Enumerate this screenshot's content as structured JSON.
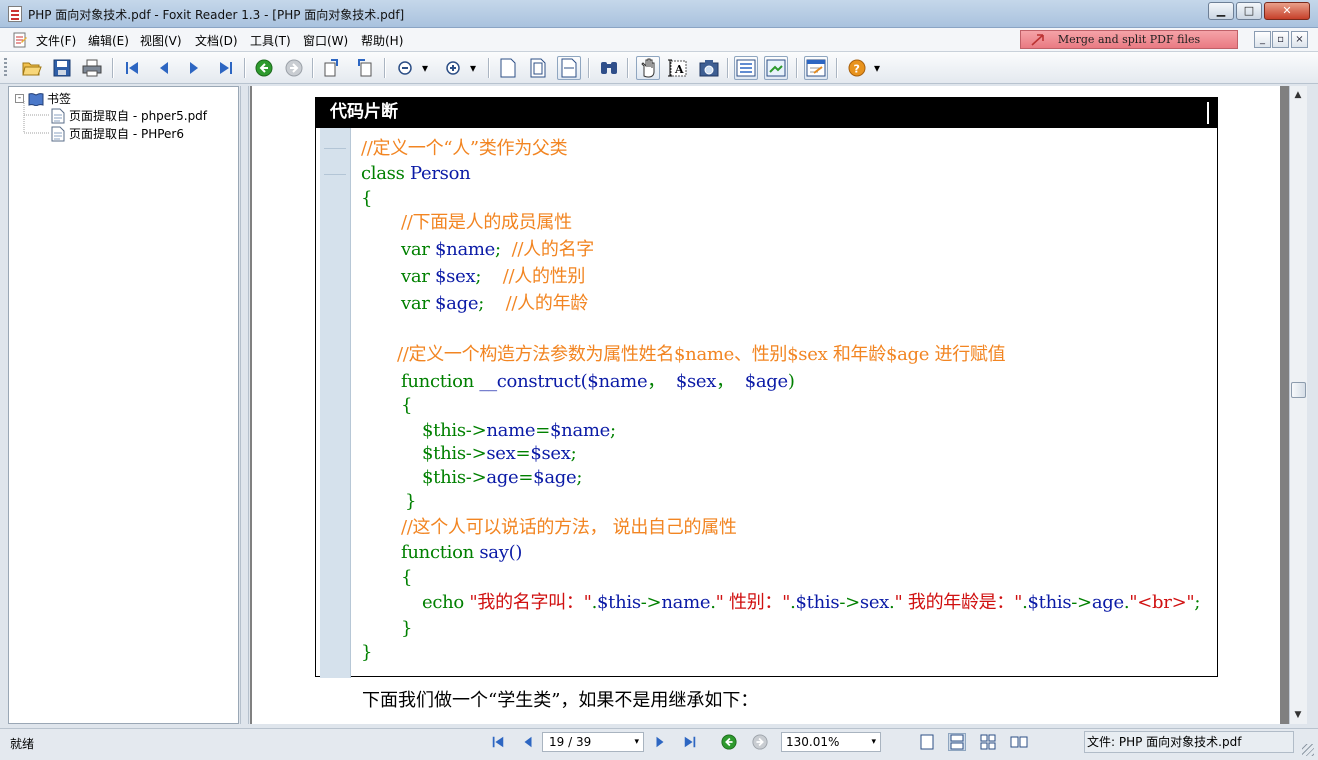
{
  "window": {
    "title": "PHP 面向对象技术.pdf - Foxit Reader 1.3 - [PHP 面向对象技术.pdf]",
    "minimize_glyph": "▁",
    "maximize_glyph": "□",
    "close_glyph": "✕"
  },
  "menu": {
    "items": [
      {
        "label": "文件(F)"
      },
      {
        "label": "编辑(E)"
      },
      {
        "label": "视图(V)"
      },
      {
        "label": "文档(D)"
      },
      {
        "label": "工具(T)"
      },
      {
        "label": "窗口(W)"
      },
      {
        "label": "帮助(H)"
      }
    ],
    "promo_label": "Merge and split PDF files",
    "mdi_minimize_glyph": "_",
    "mdi_restore_glyph": "▫",
    "mdi_close_glyph": "×"
  },
  "toolbar": {
    "icons": [
      "open-icon",
      "save-icon",
      "print-icon",
      "first-page-icon",
      "prev-page-icon",
      "next-page-icon",
      "last-page-icon",
      "back-icon",
      "forward-icon",
      "rotate-left-icon",
      "rotate-right-icon",
      "zoom-out-icon",
      "zoom-in-icon",
      "actual-size-icon",
      "fit-page-icon",
      "fit-width-icon",
      "find-icon",
      "hand-tool-icon",
      "text-select-icon",
      "snapshot-icon",
      "bookmarks-panel-icon",
      "thumbnails-panel-icon",
      "annotation-icon",
      "help-icon"
    ],
    "dropdown_glyph": "▾"
  },
  "bookmarks": {
    "root_label": "书签",
    "toggle_glyph": "-",
    "items": [
      {
        "label": "页面提取自 - phper5.pdf"
      },
      {
        "label": "页面提取自 - PHPer6"
      }
    ]
  },
  "document": {
    "box_title": "代码片断",
    "lines": [
      [
        {
          "t": "//定义一个“人”类作为父类",
          "c": "comment"
        }
      ],
      [
        {
          "t": "class ",
          "c": "kw"
        },
        {
          "t": "Person",
          "c": "id"
        }
      ],
      [
        {
          "t": "{",
          "c": "kw"
        }
      ],
      [
        {
          "t": "//下面是人的成员属性",
          "c": "comment"
        }
      ],
      [
        {
          "t": "var ",
          "c": "kw"
        },
        {
          "t": "$name",
          "c": "id"
        },
        {
          "t": ";  ",
          "c": "kw"
        },
        {
          "t": "//人的名字",
          "c": "comment"
        }
      ],
      [
        {
          "t": "var ",
          "c": "kw"
        },
        {
          "t": "$sex",
          "c": "id"
        },
        {
          "t": ";    ",
          "c": "kw"
        },
        {
          "t": "//人的性别",
          "c": "comment"
        }
      ],
      [
        {
          "t": "var ",
          "c": "kw"
        },
        {
          "t": "$age",
          "c": "id"
        },
        {
          "t": ";    ",
          "c": "kw"
        },
        {
          "t": "//人的年龄",
          "c": "comment"
        }
      ],
      [
        {
          "t": "//定义一个构造方法参数为属性姓名$name、性别$sex 和年龄$age 进行赋值",
          "c": "comment"
        }
      ],
      [
        {
          "t": "function ",
          "c": "kw"
        },
        {
          "t": "__construct(",
          "c": "id"
        },
        {
          "t": "$name",
          "c": "id"
        },
        {
          "t": "，  ",
          "c": "kw"
        },
        {
          "t": "$sex",
          "c": "id"
        },
        {
          "t": "，  ",
          "c": "kw"
        },
        {
          "t": "$age",
          "c": "id"
        },
        {
          "t": ")",
          "c": "kw"
        }
      ],
      [
        {
          "t": "{",
          "c": "kw"
        }
      ],
      [
        {
          "t": "$this",
          "c": "kw"
        },
        {
          "t": "->",
          "c": "kw"
        },
        {
          "t": "name",
          "c": "id"
        },
        {
          "t": "=",
          "c": "kw"
        },
        {
          "t": "$name",
          "c": "id"
        },
        {
          "t": ";",
          "c": "kw"
        }
      ],
      [
        {
          "t": "$this",
          "c": "kw"
        },
        {
          "t": "->",
          "c": "kw"
        },
        {
          "t": "sex",
          "c": "id"
        },
        {
          "t": "=",
          "c": "kw"
        },
        {
          "t": "$sex",
          "c": "id"
        },
        {
          "t": ";",
          "c": "kw"
        }
      ],
      [
        {
          "t": "$this",
          "c": "kw"
        },
        {
          "t": "->",
          "c": "kw"
        },
        {
          "t": "age",
          "c": "id"
        },
        {
          "t": "=",
          "c": "kw"
        },
        {
          "t": "$age",
          "c": "id"
        },
        {
          "t": ";",
          "c": "kw"
        }
      ],
      [
        {
          "t": "}",
          "c": "kw"
        }
      ],
      [
        {
          "t": "//这个人可以说话的方法， 说出自己的属性",
          "c": "comment"
        }
      ],
      [
        {
          "t": "function ",
          "c": "kw"
        },
        {
          "t": "say()",
          "c": "id"
        }
      ],
      [
        {
          "t": "{",
          "c": "kw"
        }
      ],
      [
        {
          "t": "echo ",
          "c": "kw"
        },
        {
          "t": "\"我的名字叫：\"",
          "c": "str"
        },
        {
          "t": ".",
          "c": "kw"
        },
        {
          "t": "$this",
          "c": "id"
        },
        {
          "t": "->",
          "c": "kw"
        },
        {
          "t": "name",
          "c": "id"
        },
        {
          "t": ".",
          "c": "kw"
        },
        {
          "t": "\" 性别：\"",
          "c": "str"
        },
        {
          "t": ".",
          "c": "kw"
        },
        {
          "t": "$this",
          "c": "id"
        },
        {
          "t": "->",
          "c": "kw"
        },
        {
          "t": "sex",
          "c": "id"
        },
        {
          "t": ".",
          "c": "kw"
        },
        {
          "t": "\" 我的年龄是：\"",
          "c": "str"
        },
        {
          "t": ".",
          "c": "kw"
        },
        {
          "t": "$this",
          "c": "id"
        },
        {
          "t": "->",
          "c": "kw"
        },
        {
          "t": "age",
          "c": "id"
        },
        {
          "t": ".",
          "c": "kw"
        },
        {
          "t": "\"<br>\"",
          "c": "str"
        },
        {
          "t": ";",
          "c": "kw"
        }
      ],
      [
        {
          "t": "}",
          "c": "kw"
        }
      ],
      [
        {
          "t": "}",
          "c": "kw"
        }
      ]
    ],
    "body_text": "下面我们做一个“学生类”，如果不是用继承如下："
  },
  "scrollbar": {
    "up_glyph": "▲",
    "down_glyph": "▼"
  },
  "status": {
    "ready": "就绪",
    "page_display": "19 / 39",
    "zoom": "130.01%",
    "dropdown_glyph": "▾",
    "file_label": "文件: PHP 面向对象技术.pdf"
  },
  "colors": {
    "comment": "#f28522",
    "keyword": "#008000",
    "identifier": "#0a1aa6",
    "string": "#d01010"
  }
}
